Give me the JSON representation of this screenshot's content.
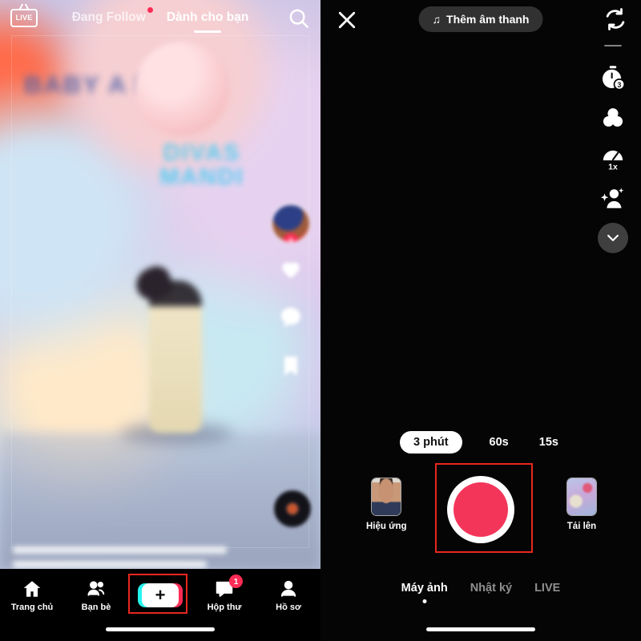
{
  "feed": {
    "top": {
      "live_label": "LIVE",
      "live_icon": "live-tv-icon",
      "search_icon": "search-icon",
      "tabs": [
        {
          "label": "Đang Follow",
          "active": false,
          "has_dot": true
        },
        {
          "label": "Dành cho bạn",
          "active": true,
          "has_dot": false
        }
      ]
    },
    "video": {
      "overlay_title": "BABY A       D FRIE",
      "overlay_subtitle": "DIVAS\nMANDI",
      "rail": {
        "avatar_icon": "avatar",
        "follow_icon": "plus-icon",
        "actions": [
          {
            "icon": "heart-icon",
            "count": ""
          },
          {
            "icon": "comment-icon",
            "count": ""
          },
          {
            "icon": "bookmark-icon",
            "count": ""
          }
        ],
        "disc_icon": "music-disc-icon"
      }
    },
    "bottom_nav": [
      {
        "label": "Trang chủ",
        "icon": "home-icon",
        "badge": ""
      },
      {
        "label": "Bạn bè",
        "icon": "friends-icon",
        "badge": ""
      },
      {
        "label": "",
        "icon": "create-plus-icon",
        "badge": "",
        "create": true,
        "plus": "+"
      },
      {
        "label": "Hộp thư",
        "icon": "inbox-icon",
        "badge": "1"
      },
      {
        "label": "Hồ sơ",
        "icon": "profile-icon",
        "badge": ""
      }
    ],
    "highlight_color": "#e8271f"
  },
  "camera": {
    "close_icon": "close-icon",
    "sound_button": {
      "label": "Thêm âm thanh",
      "icon": "music-note-icon",
      "glyph": "♫"
    },
    "flip_icon": "flip-camera-icon",
    "tools": [
      {
        "name": "timer-tool",
        "icon": "stopwatch-icon",
        "value": "3"
      },
      {
        "name": "filters-tool",
        "icon": "filters-icon",
        "value": ""
      },
      {
        "name": "speed-tool",
        "icon": "speedometer-icon",
        "value": "1x"
      },
      {
        "name": "beautify-tool",
        "icon": "beautify-icon",
        "value": ""
      }
    ],
    "collapse_icon": "chevron-down-icon",
    "durations": [
      {
        "label": "3 phút",
        "selected": true
      },
      {
        "label": "60s",
        "selected": false
      },
      {
        "label": "15s",
        "selected": false
      }
    ],
    "effects_button": {
      "label": "Hiệu ứng",
      "icon": "effects-thumbnail"
    },
    "upload_button": {
      "label": "Tải lên",
      "icon": "upload-thumbnail"
    },
    "shutter": {
      "name": "record-button",
      "color": "#f4355a"
    },
    "modes": [
      {
        "label": "Máy ảnh",
        "active": true
      },
      {
        "label": "Nhật ký",
        "active": false
      },
      {
        "label": "LIVE",
        "active": false
      }
    ]
  }
}
